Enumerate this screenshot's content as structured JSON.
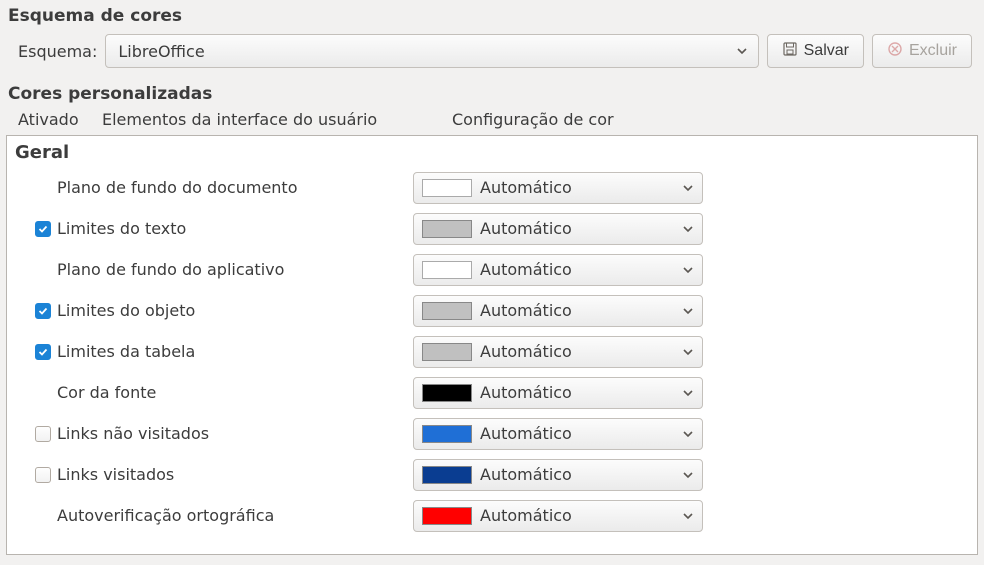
{
  "section1_title": "Esquema de cores",
  "scheme_label": "Esquema:",
  "scheme_value": "LibreOffice",
  "save_label": "Salvar",
  "delete_label": "Excluir",
  "section2_title": "Cores personalizadas",
  "header_col1": "Ativado",
  "header_col2": "Elementos da interface do usuário",
  "header_col3": "Configuração de cor",
  "group_label": "Geral",
  "automatic_label": "Automático",
  "rows": [
    {
      "label": "Plano de fundo do documento",
      "checkable": false,
      "checked": false,
      "swatch": "#ffffff"
    },
    {
      "label": "Limites do texto",
      "checkable": true,
      "checked": true,
      "swatch": "#c0c0c0"
    },
    {
      "label": "Plano de fundo do aplicativo",
      "checkable": false,
      "checked": false,
      "swatch": "#ffffff"
    },
    {
      "label": "Limites do objeto",
      "checkable": true,
      "checked": true,
      "swatch": "#c0c0c0"
    },
    {
      "label": "Limites da tabela",
      "checkable": true,
      "checked": true,
      "swatch": "#c0c0c0"
    },
    {
      "label": "Cor da fonte",
      "checkable": false,
      "checked": false,
      "swatch": "#000000"
    },
    {
      "label": "Links não visitados",
      "checkable": true,
      "checked": false,
      "swatch": "#1f6fd6"
    },
    {
      "label": "Links visitados",
      "checkable": true,
      "checked": false,
      "swatch": "#0a3d91"
    },
    {
      "label": "Autoverificação ortográfica",
      "checkable": false,
      "checked": false,
      "swatch": "#ff0000"
    }
  ]
}
